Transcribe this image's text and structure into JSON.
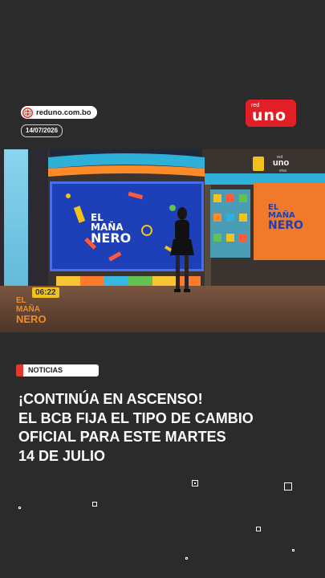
{
  "source": {
    "site": "reduno.com.bo",
    "date": "14/07/2026"
  },
  "logo": {
    "small": "red",
    "big": "uno"
  },
  "photo": {
    "brand": "EL MAÑA NERO",
    "brand_lines": [
      "EL",
      "MAÑA",
      "NERO"
    ],
    "clock": "06:22",
    "channel_badge": {
      "small": "red",
      "big": "uno",
      "sub": "viva"
    }
  },
  "category": "NOTICIAS",
  "headline": [
    "¡CONTINÚA EN ASCENSO!",
    "EL BCB FIJA EL TIPO DE CAMBIO",
    "OFICIAL PARA ESTE MARTES",
    "14 DE JULIO"
  ],
  "colors": {
    "accent": "#e03a2f",
    "background": "#2b2b2b"
  }
}
